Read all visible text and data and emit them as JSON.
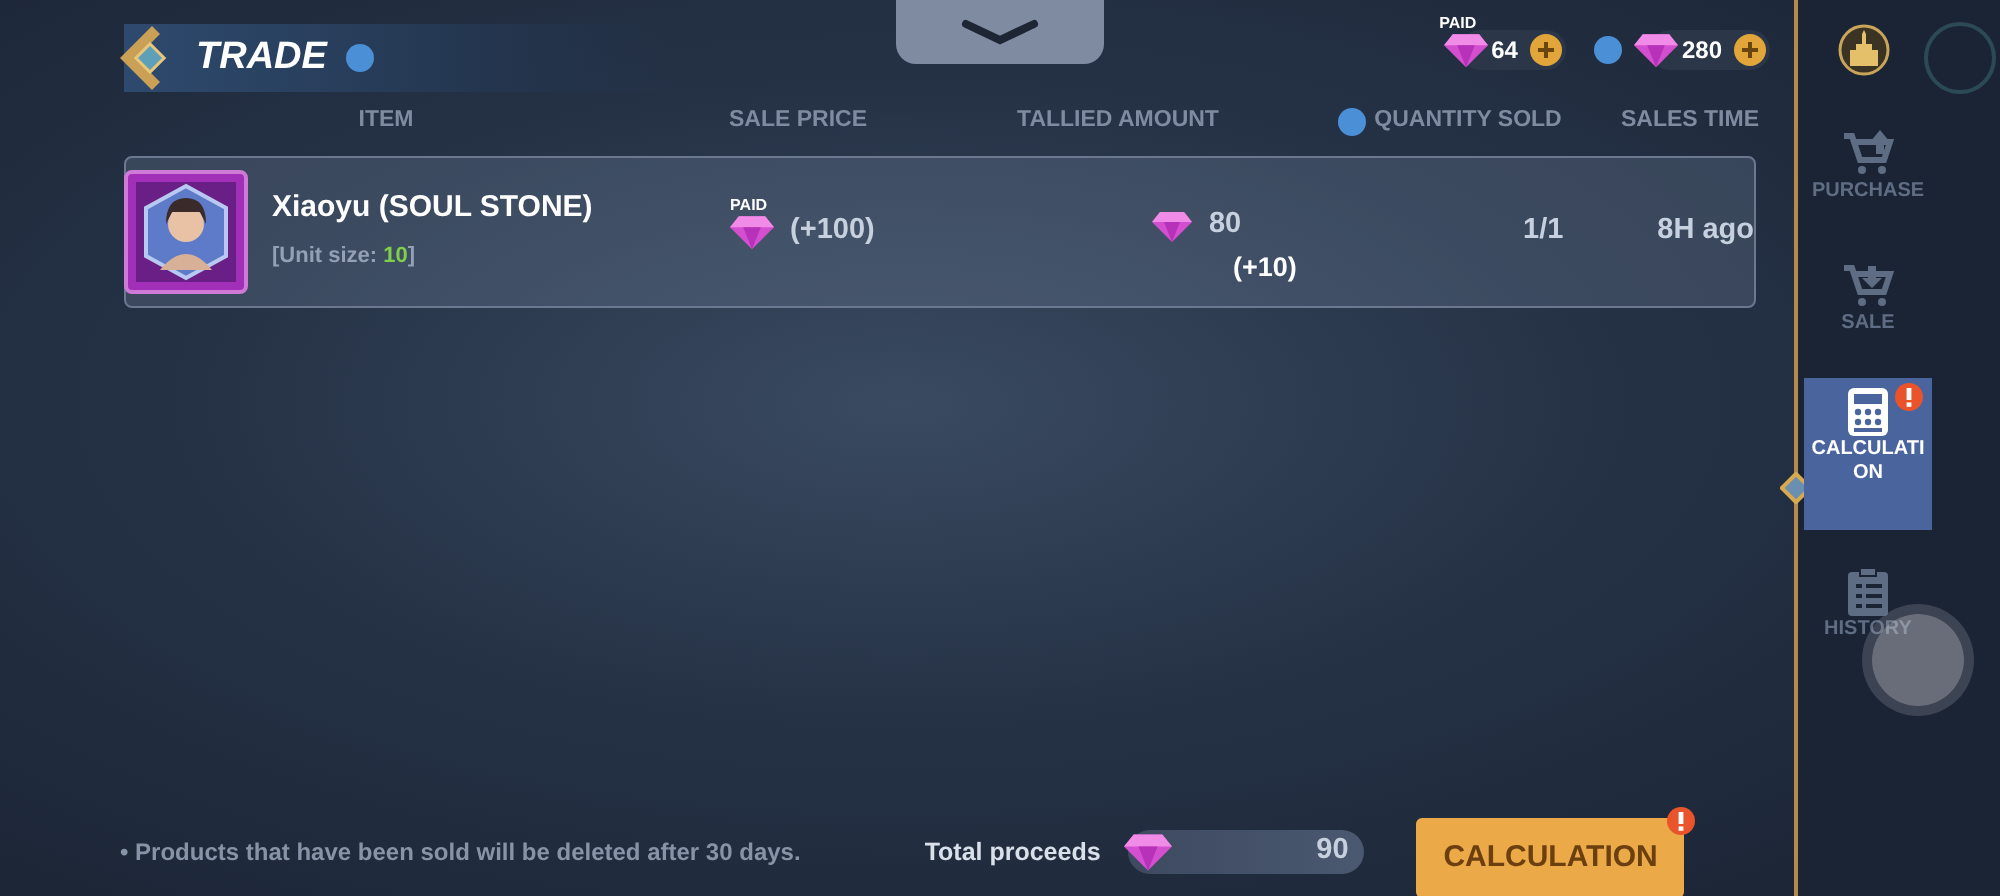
{
  "header": {
    "title": "TRADE"
  },
  "currencies": [
    {
      "kind": "paid",
      "badge": "PAID",
      "amount": "64"
    },
    {
      "kind": "free",
      "amount": "280"
    }
  ],
  "table": {
    "columns": [
      "ITEM",
      "SALE PRICE",
      "TALLIED AMOUNT",
      "QUANTITY SOLD",
      "SALES TIME"
    ],
    "rows": [
      {
        "name": "Xiaoyu (SOUL STONE)",
        "unit_prefix": "[Unit size: ",
        "unit_size": "10",
        "unit_suffix": "]",
        "price_badge": "PAID",
        "sale_price": "(+100)",
        "tallied": "80",
        "tallied_bonus": "(+10)",
        "quantity": "1/1",
        "time": "8H ago"
      }
    ]
  },
  "sidebar": {
    "items": [
      {
        "kind": "purchase",
        "label": "PURCHASE",
        "selected": false,
        "alert": false
      },
      {
        "kind": "sale",
        "label": "SALE",
        "selected": false,
        "alert": false
      },
      {
        "kind": "calculation",
        "label": "CALCULATION",
        "selected": true,
        "alert": true
      },
      {
        "kind": "history",
        "label": "HISTORY",
        "selected": false,
        "alert": false
      }
    ]
  },
  "footer": {
    "note": "• Products that have been sold will be deleted after 30 days.",
    "total_label": "Total proceeds",
    "total": "90",
    "button": "CALCULATION",
    "button_alert": true
  }
}
